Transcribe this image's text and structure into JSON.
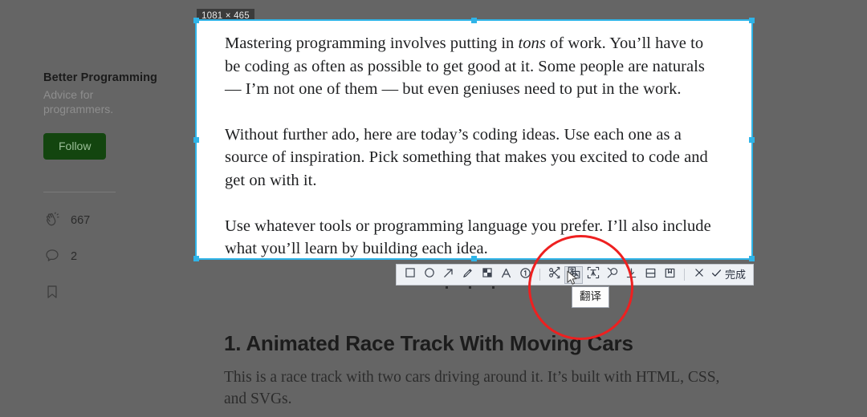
{
  "capture": {
    "dimension_badge": "1081 × 465",
    "paragraphs": [
      {
        "id": "p1",
        "segments": [
          {
            "text": "Mastering programming involves putting in ",
            "italic": false
          },
          {
            "text": "tons",
            "italic": true
          },
          {
            "text": " of work. You’ll have to be coding as often as possible to get good at it. Some people are naturals — I’m not one of them — but even geniuses need to put in the work.",
            "italic": false
          }
        ]
      },
      {
        "id": "p2",
        "segments": [
          {
            "text": "Without further ado, here are today’s coding ideas. Use each one as a source of inspiration. Pick something that makes you excited to code and get on with it.",
            "italic": false
          }
        ]
      },
      {
        "id": "p3",
        "segments": [
          {
            "text": "Use whatever tools or programming language you prefer. I’ll also include what you’ll learn by building each idea.",
            "italic": false
          }
        ]
      }
    ]
  },
  "sidebar": {
    "publication_title": "Better Programming",
    "publication_description": "Advice for programmers.",
    "follow_label": "Follow",
    "stats": [
      {
        "icon": "clap-icon",
        "name": "claps",
        "value": "667"
      },
      {
        "icon": "comment-icon",
        "name": "comments",
        "value": "2"
      },
      {
        "icon": "bookmark-icon",
        "name": "bookmark",
        "value": ""
      }
    ]
  },
  "article_below": {
    "heading": "1. Animated Race Track With Moving Cars",
    "body": "This is a race track with two cars driving around it. It’s built with HTML, CSS, and SVGs."
  },
  "toolbar": {
    "tools": [
      {
        "name": "rectangle-tool",
        "icon": "square-icon",
        "active": false
      },
      {
        "name": "ellipse-tool",
        "icon": "circle-icon",
        "active": false
      },
      {
        "name": "arrow-tool",
        "icon": "arrow-up-right-icon",
        "active": false
      },
      {
        "name": "pen-tool",
        "icon": "pencil-icon",
        "active": false
      },
      {
        "name": "mosaic-tool",
        "icon": "mosaic-icon",
        "active": false
      },
      {
        "name": "text-tool",
        "icon": "letter-a-icon",
        "active": false
      },
      {
        "name": "step-number-tool",
        "icon": "numbered-circle-icon",
        "active": false
      }
    ],
    "actions": [
      {
        "name": "ocr-extract-button",
        "icon": "ocr-scissors-icon",
        "active": false
      },
      {
        "name": "translate-button",
        "icon": "translate-icon",
        "active": true
      },
      {
        "name": "text-recognition-button",
        "icon": "text-frame-icon",
        "active": false
      },
      {
        "name": "search-image-button",
        "icon": "magnifier-icon",
        "active": false
      },
      {
        "name": "save-button",
        "icon": "download-icon",
        "active": false
      },
      {
        "name": "pin-to-screen-button",
        "icon": "pin-window-icon",
        "active": false
      },
      {
        "name": "bookmark-button",
        "icon": "bookmark-flag-icon",
        "active": false
      }
    ],
    "cancel": {
      "name": "cancel-button",
      "icon": "close-x-icon"
    },
    "confirm": {
      "name": "confirm-button",
      "icon": "check-icon",
      "label": "完成"
    }
  },
  "tooltip": {
    "text": "翻译"
  },
  "colors": {
    "selection_border": "#2fb4e8",
    "follow_button": "#13450f",
    "annotation_red": "#ee2020",
    "toolbar_background": "#eef1f5",
    "dim_overlay": "#656565"
  }
}
